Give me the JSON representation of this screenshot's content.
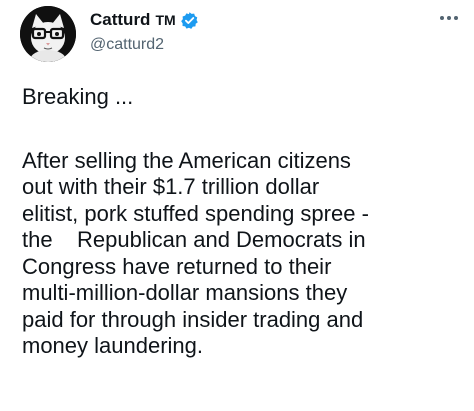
{
  "author": {
    "display_name": "Catturd",
    "tm": "TM",
    "handle": "@catturd2",
    "verified_color": "#1d9bf0"
  },
  "icons": {
    "avatar": "cat-with-glasses-avatar",
    "verified": "verified-badge-icon",
    "more": "more-options-icon"
  },
  "tweet": {
    "line_1": "Breaking ...",
    "body_lines": [
      "After selling the American citizens",
      "out with their $1.7 trillion dollar",
      "elitist, pork stuffed spending spree -",
      "the    Republican and Democrats in",
      "Congress have returned to their",
      "multi-million-dollar mansions they",
      "paid for through insider trading and",
      "money laundering."
    ]
  }
}
